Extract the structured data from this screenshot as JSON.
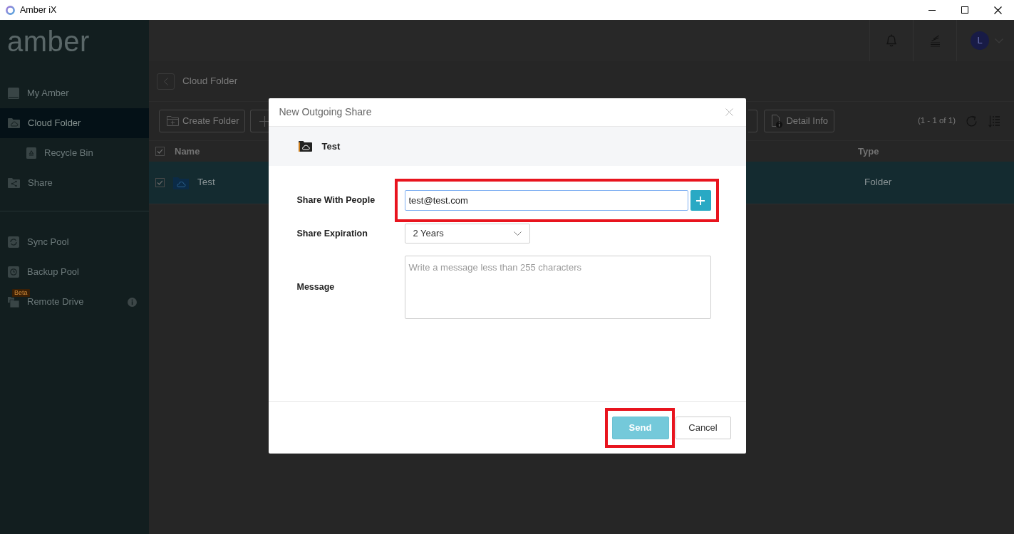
{
  "window": {
    "title": "Amber iX"
  },
  "sidebar": {
    "logo": "amber",
    "sections": [
      {
        "items": [
          {
            "label": "My Amber",
            "selected": false
          },
          {
            "label": "Cloud Folder",
            "selected": true,
            "children": [
              {
                "label": "Recycle Bin",
                "selected": false
              }
            ]
          },
          {
            "label": "Share",
            "selected": false
          }
        ]
      },
      {
        "items": [
          {
            "label": "Sync Pool",
            "selected": false
          },
          {
            "label": "Backup Pool",
            "selected": false
          },
          {
            "label": "Remote Drive",
            "selected": false,
            "badge": "Beta",
            "info": true
          }
        ]
      }
    ]
  },
  "topbar": {
    "avatar_initial": "L"
  },
  "breadcrumb": {
    "title": "Cloud Folder"
  },
  "toolbar": {
    "left_buttons": [
      {
        "label": "Create Folder"
      }
    ],
    "right_buttons": [
      {
        "label": "Detail Info"
      }
    ],
    "count": "(1 - 1 of 1)"
  },
  "table": {
    "columns": [
      "Name",
      "Type"
    ],
    "all_checked": true,
    "rows": [
      {
        "name": "Test",
        "type": "Folder",
        "checked": true,
        "selected": true
      }
    ]
  },
  "dialog": {
    "title": "New Outgoing Share",
    "item": "Test",
    "fields": [
      {
        "kind": "input",
        "label": "Share With People",
        "value": "test@test.com",
        "highlighted": true
      },
      {
        "kind": "select",
        "label": "Share Expiration",
        "value": "2 Years"
      },
      {
        "kind": "textarea",
        "label": "Message",
        "placeholder": "Write a message less than 255 characters"
      }
    ],
    "buttons": [
      {
        "kind": "primary",
        "label": "Send",
        "highlighted": true
      },
      {
        "kind": "secondary",
        "label": "Cancel",
        "highlighted": false
      }
    ]
  }
}
